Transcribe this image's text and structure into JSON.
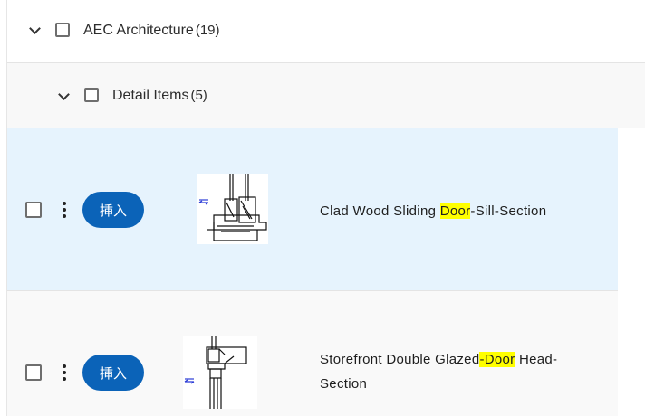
{
  "category": {
    "name": "AEC Architecture",
    "count": "(19)"
  },
  "subcategory": {
    "name": "Detail Items",
    "count": "(5)"
  },
  "items": [
    {
      "insert_label": "挿入",
      "title_before": "Clad Wood Sliding ",
      "title_match": "Door",
      "title_after": "-Sill-Section",
      "thumbnail": "door-sill-section-drawing"
    },
    {
      "insert_label": "挿入",
      "title_before": "Storefront Double Glazed",
      "title_match": "-Door",
      "title_after": " Head-",
      "title_line2": "Section",
      "thumbnail": "door-head-section-drawing"
    }
  ],
  "colors": {
    "selected_row": "#e6f3fd",
    "button": "#0b63b8",
    "highlight": "#ffff00"
  }
}
